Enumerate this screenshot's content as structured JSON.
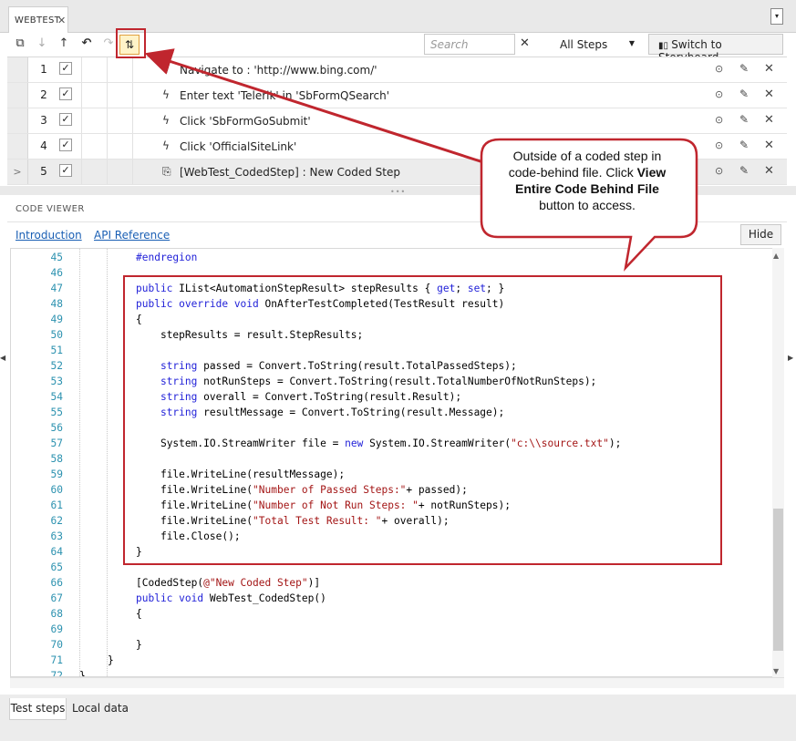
{
  "tab": {
    "title": "WEBTEST",
    "close": "✕",
    "menu": "▾"
  },
  "toolbar": {
    "search_placeholder": "Search",
    "search_clear": "✕",
    "filter_value": "All Steps",
    "storyboard_label": "Switch to Storyboard"
  },
  "steps": [
    {
      "num": "1",
      "desc": "Navigate to : 'http://www.bing.com/'",
      "checked": "✓"
    },
    {
      "num": "2",
      "desc": "Enter text 'Telerik' in 'SbFormQSearch'",
      "checked": "✓"
    },
    {
      "num": "3",
      "desc": "Click 'SbFormGoSubmit'",
      "checked": "✓"
    },
    {
      "num": "4",
      "desc": "Click 'OfficialSiteLink'",
      "checked": "✓"
    },
    {
      "num": "5",
      "desc": "[WebTest_CodedStep] : New Coded Step",
      "checked": "✓"
    }
  ],
  "code_viewer": {
    "title": "CODE VIEWER",
    "link_intro": "Introduction",
    "link_api": "API Reference",
    "hide_label": "Hide"
  },
  "code_lines": [
    {
      "n": "45",
      "t": "#endregion"
    },
    {
      "n": "46",
      "t": ""
    },
    {
      "n": "47",
      "t": "public IList<AutomationStepResult> stepResults { get; set; }"
    },
    {
      "n": "48",
      "t": "public override void OnAfterTestCompleted(TestResult result)"
    },
    {
      "n": "49",
      "t": "{"
    },
    {
      "n": "50",
      "t": "    stepResults = result.StepResults;"
    },
    {
      "n": "51",
      "t": ""
    },
    {
      "n": "52",
      "t": "    string passed = Convert.ToString(result.TotalPassedSteps);"
    },
    {
      "n": "53",
      "t": "    string notRunSteps = Convert.ToString(result.TotalNumberOfNotRunSteps);"
    },
    {
      "n": "54",
      "t": "    string overall = Convert.ToString(result.Result);"
    },
    {
      "n": "55",
      "t": "    string resultMessage = Convert.ToString(result.Message);"
    },
    {
      "n": "56",
      "t": ""
    },
    {
      "n": "57",
      "t": "    System.IO.StreamWriter file = new System.IO.StreamWriter(\"c:\\\\source.txt\");"
    },
    {
      "n": "58",
      "t": ""
    },
    {
      "n": "59",
      "t": "    file.WriteLine(resultMessage);"
    },
    {
      "n": "60",
      "t": "    file.WriteLine(\"Number of Passed Steps:\"+ passed);"
    },
    {
      "n": "61",
      "t": "    file.WriteLine(\"Number of Not Run Steps: \"+ notRunSteps);"
    },
    {
      "n": "62",
      "t": "    file.WriteLine(\"Total Test Result: \"+ overall);"
    },
    {
      "n": "63",
      "t": "    file.Close();"
    },
    {
      "n": "64",
      "t": "}"
    },
    {
      "n": "65",
      "t": ""
    },
    {
      "n": "66",
      "t": "[CodedStep(@\"New Coded Step\")]"
    },
    {
      "n": "67",
      "t": "public void WebTest_CodedStep()"
    },
    {
      "n": "68",
      "t": "{"
    },
    {
      "n": "69",
      "t": ""
    },
    {
      "n": "70",
      "t": "}"
    },
    {
      "n": "71",
      "t": "}"
    },
    {
      "n": "72",
      "t": "}"
    }
  ],
  "bottom_tabs": {
    "steps": "Test steps",
    "local": "Local data"
  },
  "callout": {
    "line1": "Outside of a coded step in",
    "line2": "code-behind file. Click ",
    "bold1": "View",
    "bold2": "Entire Code Behind File",
    "line4": "button to access."
  },
  "colors": {
    "accent_red": "#c0262e",
    "keyword": "#1f1fd8",
    "string": "#a31515",
    "line_number": "#2b91af"
  }
}
